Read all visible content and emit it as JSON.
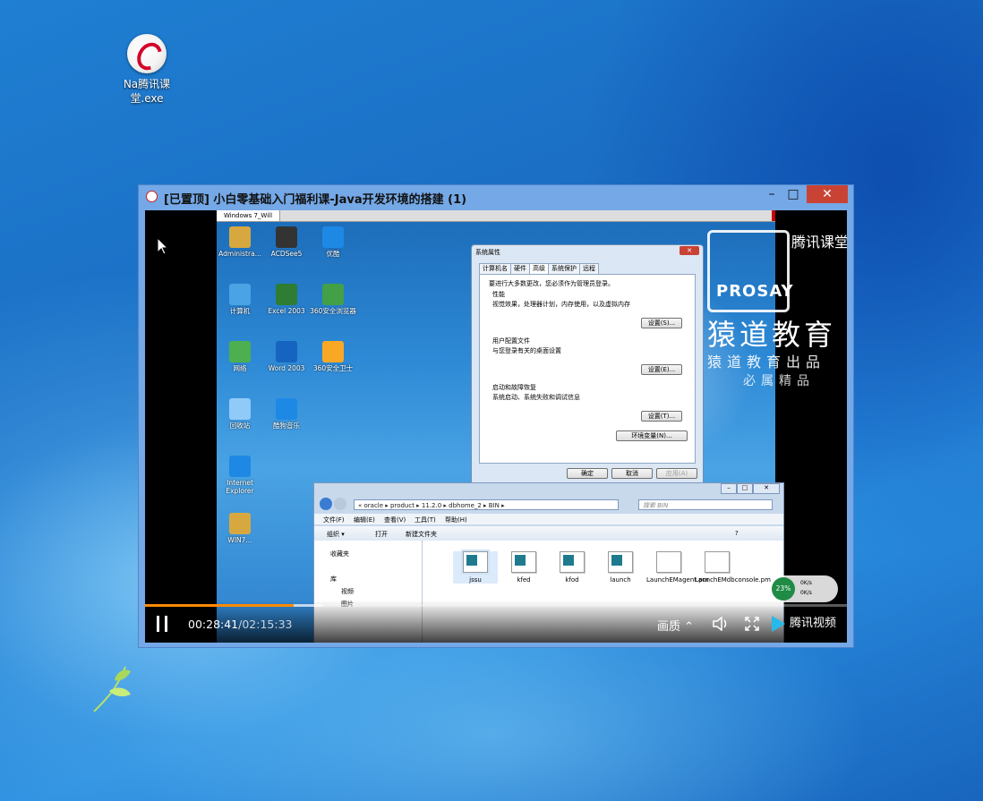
{
  "desktop": {
    "icon_label": "Na腾讯课堂.exe"
  },
  "window": {
    "title": "[已置顶] 小白零基础入门福利课-Java开发环境的搭建 (1)",
    "minimize": "–",
    "maximize": "□",
    "close": "✕"
  },
  "vm": {
    "tab": "Windows 7_Will",
    "icons": [
      {
        "label": "Administra...",
        "icon": "folder-icon",
        "color": "#d8a840"
      },
      {
        "label": "ACDSee5",
        "icon": "eye-icon",
        "color": "#333333"
      },
      {
        "label": "优酷",
        "icon": "play-icon",
        "color": "#1e88e5"
      },
      {
        "label": "计算机",
        "icon": "computer-icon",
        "color": "#4aa3e4"
      },
      {
        "label": "Excel 2003",
        "icon": "excel-icon",
        "color": "#2e7d32"
      },
      {
        "label": "360安全浏览器",
        "icon": "browser-icon",
        "color": "#43a047"
      },
      {
        "label": "网络",
        "icon": "network-icon",
        "color": "#4caf50"
      },
      {
        "label": "Word 2003",
        "icon": "word-icon",
        "color": "#1565c0"
      },
      {
        "label": "360安全卫士",
        "icon": "shield-plus-icon",
        "color": "#f9a825"
      },
      {
        "label": "回收站",
        "icon": "recycle-bin-icon",
        "color": "#90caf9"
      },
      {
        "label": "酷狗音乐",
        "icon": "music-icon",
        "color": "#1e88e5"
      },
      {
        "label": "Internet Explorer",
        "icon": "ie-icon",
        "color": "#1e88e5"
      },
      {
        "label": "WIN7...",
        "icon": "folder-icon",
        "color": "#d8a840"
      }
    ],
    "brand": {
      "ketang": "腾讯课堂",
      "logo": "PROSAY",
      "edu": "猿道教育",
      "sub": "猿道教育出品",
      "sub2": "必属精品"
    },
    "dialog": {
      "title": "系统属性",
      "tabs": [
        "计算机名",
        "硬件",
        "高级",
        "系统保护",
        "远程"
      ],
      "selected_tab": "高级",
      "admin_note": "要进行大多数更改，您必须作为管理员登录。",
      "perf_title": "性能",
      "perf_desc": "视觉效果，处理器计划，内存使用，以及虚拟内存",
      "profile_title": "用户配置文件",
      "profile_desc": "与您登录有关的桌面设置",
      "startup_title": "启动和故障恢复",
      "startup_desc": "系统启动、系统失败和调试信息",
      "settings_btn1": "设置(S)...",
      "settings_btn2": "设置(E)...",
      "settings_btn3": "设置(T)...",
      "env_btn": "环境变量(N)...",
      "ok": "确定",
      "cancel": "取消",
      "apply": "应用(A)"
    },
    "explorer": {
      "address": "« oracle ▸ product ▸ 11.2.0 ▸ dbhome_2 ▸ BIN ▸",
      "search_placeholder": "搜索 BIN",
      "menu": [
        "文件(F)",
        "编辑(E)",
        "查看(V)",
        "工具(T)",
        "帮助(H)"
      ],
      "toolbar": [
        "组织 ▾",
        "打开",
        "新建文件夹"
      ],
      "side": [
        "收藏夹",
        "库",
        "视频",
        "图片"
      ],
      "files": [
        "jssu",
        "kfed",
        "kfod",
        "launch",
        "LaunchEMagent.pm",
        "LaunchEMdbconsole.pm"
      ]
    },
    "net": {
      "percent": "23%",
      "up": "0K/s",
      "down": "0K/s"
    }
  },
  "player": {
    "progress_fraction": 0.212,
    "buffer_fraction": 0.254,
    "current_time": "00:28:41",
    "duration": "/02:15:33",
    "quality": "画质",
    "brand": "腾讯视频"
  }
}
